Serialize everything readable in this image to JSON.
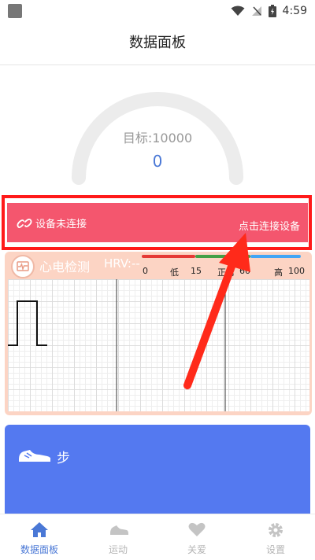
{
  "status_bar": {
    "time": "4:59"
  },
  "header": {
    "title": "数据面板"
  },
  "gauge": {
    "target_label": "目标:10000",
    "value": "0",
    "progress": 0
  },
  "connection": {
    "status_text": "设备未连接",
    "connect_text": "点击连接设备"
  },
  "ecg": {
    "title": "心电检测",
    "hrv_label": "HRV:--",
    "scale": {
      "low_label": "低",
      "normal_label": "正常",
      "high_label": "高",
      "ticks": [
        "0",
        "15",
        "60",
        "100"
      ]
    }
  },
  "steps": {
    "label": "步"
  },
  "nav": {
    "items": [
      {
        "label": "数据面板",
        "active": true
      },
      {
        "label": "运动"
      },
      {
        "label": "关爱"
      },
      {
        "label": "设置"
      }
    ]
  },
  "colors": {
    "accent": "#4a78d6",
    "banner": "#f4566e",
    "steps_card": "#5479f0",
    "ecg_card": "#fcd4c4"
  }
}
